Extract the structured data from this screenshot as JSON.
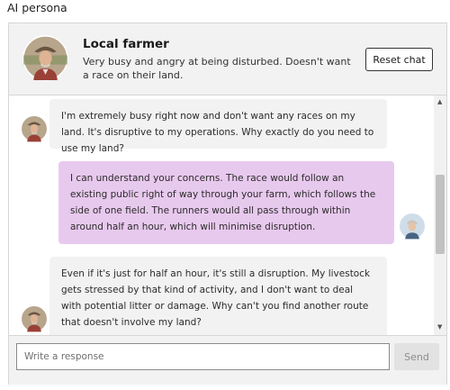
{
  "page": {
    "title": "AI persona"
  },
  "persona": {
    "name": "Local farmer",
    "description": "Very busy and angry at being disturbed. Doesn't want a race on their land.",
    "avatar_icon": "farmer-avatar"
  },
  "header": {
    "reset_label": "Reset chat"
  },
  "messages": [
    {
      "role": "ai",
      "text": "I'm extremely busy right now and don't want any races on my land. It's disruptive to my operations. Why exactly do you need to use my land?"
    },
    {
      "role": "user",
      "text": "I can understand your concerns. The race would follow an existing public right of way through your farm, which follows the side of one field. The runners would all pass through within around half an hour, which will minimise disruption."
    },
    {
      "role": "ai",
      "text": "Even if it's just for half an hour, it's still a disruption. My livestock gets stressed by that kind of activity, and I don't want to deal with potential litter or damage. Why can't you find another route that doesn't involve my land?"
    }
  ],
  "composer": {
    "placeholder": "Write a response",
    "send_label": "Send"
  },
  "colors": {
    "user_bubble": "#e8c9ee",
    "ai_bubble": "#f2f2f2",
    "panel_bg": "#f2f2f2"
  }
}
